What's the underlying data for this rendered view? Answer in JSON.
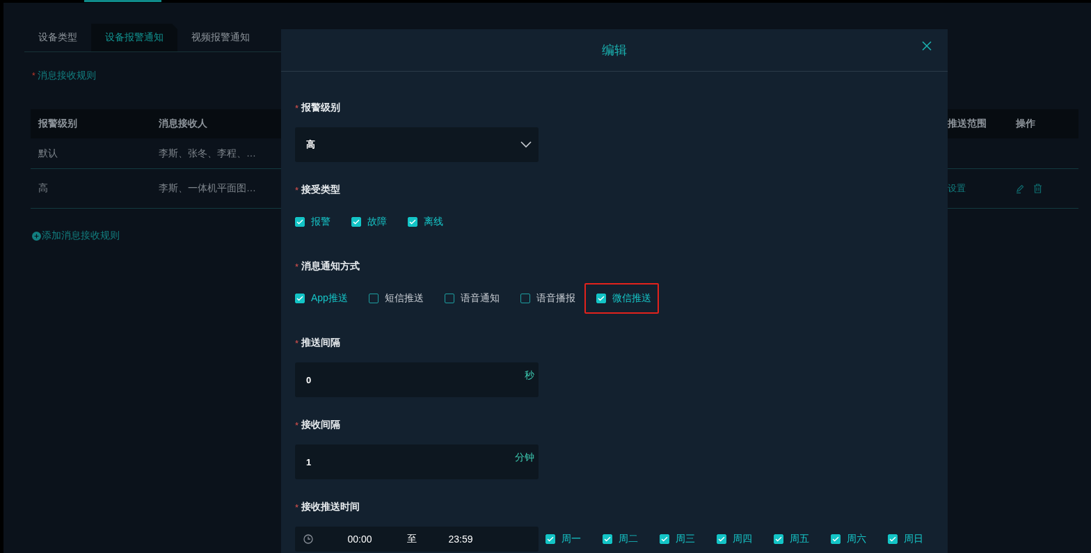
{
  "tabs": [
    {
      "label": "设备类型",
      "selected": false
    },
    {
      "label": "设备报警通知",
      "selected": true
    },
    {
      "label": "视频报警通知",
      "selected": false
    }
  ],
  "rules_section": {
    "mark": "*",
    "title": "消息接收规则"
  },
  "table": {
    "columns": [
      "报警级别",
      "消息接收人",
      "推送范围",
      "操作"
    ],
    "rows": [
      {
        "level": "默认",
        "receivers": "李斯、张冬、李程、…",
        "has_actions": false
      },
      {
        "level": "高",
        "receivers": "李斯、一体机平面图…",
        "push_range": "设置",
        "has_actions": true
      }
    ]
  },
  "add_rule_link": "添加消息接收规则",
  "dialog": {
    "title": "编辑",
    "fields": [
      {
        "kind": "select",
        "mark": "*",
        "label": "报警级别",
        "value": "高"
      },
      {
        "kind": "checks",
        "mark": "*",
        "label": "接受类型",
        "options": [
          {
            "label": "报警",
            "checked": true,
            "highlighted": false
          },
          {
            "label": "故障",
            "checked": true,
            "highlighted": false
          },
          {
            "label": "离线",
            "checked": true,
            "highlighted": false
          }
        ]
      },
      {
        "kind": "checks",
        "mark": "*",
        "label": "消息通知方式",
        "options": [
          {
            "label": "App推送",
            "checked": true,
            "highlighted": false
          },
          {
            "label": "短信推送",
            "checked": false,
            "highlighted": false
          },
          {
            "label": "语音通知",
            "checked": false,
            "highlighted": false
          },
          {
            "label": "语音播报",
            "checked": false,
            "highlighted": false
          },
          {
            "label": "微信推送",
            "checked": true,
            "highlighted": true
          }
        ]
      },
      {
        "kind": "number",
        "mark": "*",
        "label": "推送间隔",
        "value": "0",
        "unit": "秒"
      },
      {
        "kind": "number",
        "mark": "*",
        "label": "接收间隔",
        "value": "1",
        "unit": "分钟"
      },
      {
        "kind": "timerange",
        "mark": "*",
        "label": "接收推送时间",
        "start": "00:00",
        "separator": "至",
        "end": "23:59",
        "days": [
          {
            "label": "周一",
            "checked": true
          },
          {
            "label": "周二",
            "checked": true
          },
          {
            "label": "周三",
            "checked": true
          },
          {
            "label": "周四",
            "checked": true
          },
          {
            "label": "周五",
            "checked": true
          },
          {
            "label": "周六",
            "checked": true
          },
          {
            "label": "周日",
            "checked": true
          }
        ]
      }
    ]
  }
}
